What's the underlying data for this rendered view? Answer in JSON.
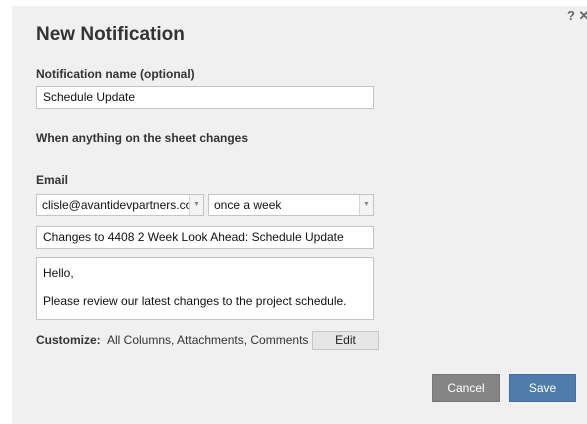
{
  "dialog": {
    "title": "New Notification",
    "help_icons": "? ✕"
  },
  "name_field": {
    "label": "Notification name (optional)",
    "value": "Schedule Update"
  },
  "trigger": {
    "text": "When anything on the sheet changes"
  },
  "email": {
    "label": "Email",
    "recipient": "clisle@avantidevpartners.co",
    "frequency": "once a week",
    "subject": "Changes to 4408 2 Week Look Ahead: Schedule Update",
    "message_lines": [
      "Hello,",
      "Please review our latest changes to the project schedule."
    ]
  },
  "customize": {
    "label": "Customize:",
    "value": "All Columns, Attachments, Comments",
    "edit_label": "Edit"
  },
  "footer": {
    "cancel_label": "Cancel",
    "save_label": "Save"
  }
}
